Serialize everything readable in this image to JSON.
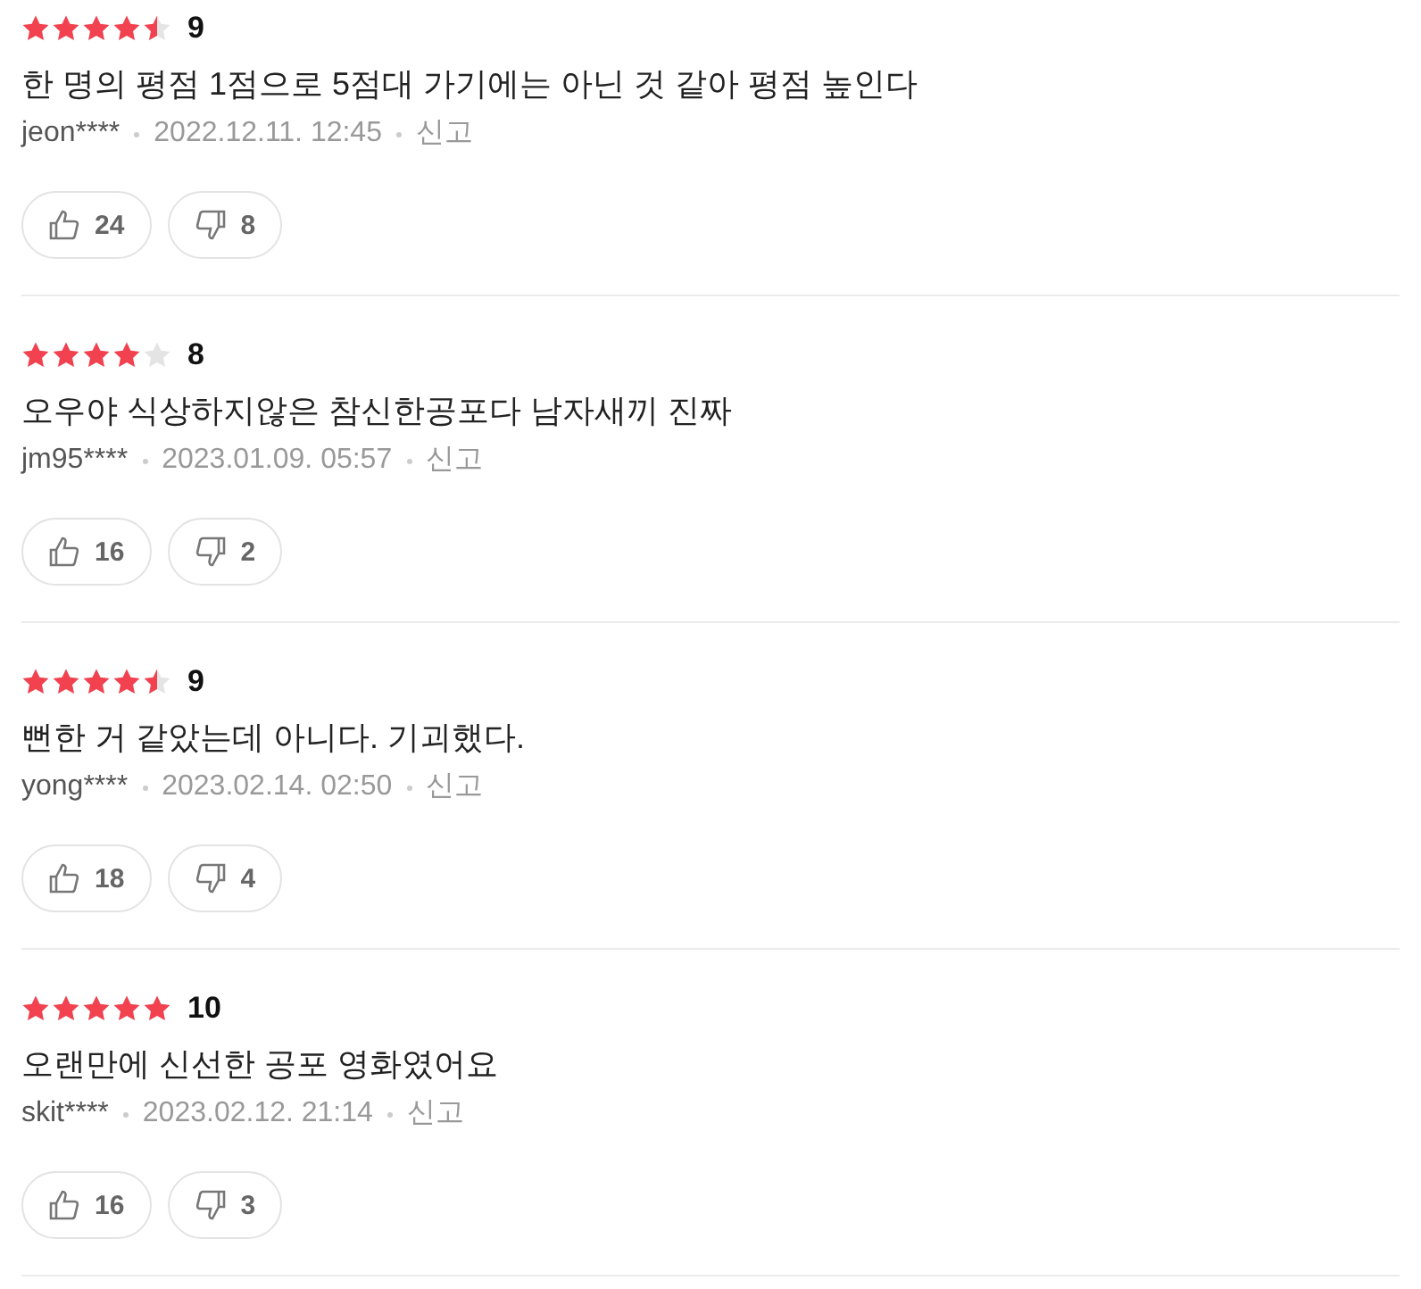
{
  "reviews": [
    {
      "stars": 4.5,
      "score": "9",
      "text": "한 명의 평점 1점으로 5점대 가기에는 아닌 것 같아 평점 높인다",
      "user": "jeon****",
      "date": "2022.12.11. 12:45",
      "report": "신고",
      "likes": "24",
      "dislikes": "8"
    },
    {
      "stars": 4,
      "score": "8",
      "text": "오우야 식상하지않은 참신한공포다 남자새끼 진짜",
      "user": "jm95****",
      "date": "2023.01.09. 05:57",
      "report": "신고",
      "likes": "16",
      "dislikes": "2"
    },
    {
      "stars": 4.5,
      "score": "9",
      "text": "뻔한 거 같았는데 아니다. 기괴했다.",
      "user": "yong****",
      "date": "2023.02.14. 02:50",
      "report": "신고",
      "likes": "18",
      "dislikes": "4"
    },
    {
      "stars": 5,
      "score": "10",
      "text": "오랜만에 신선한 공포 영화였어요",
      "user": "skit****",
      "date": "2023.02.12. 21:14",
      "report": "신고",
      "likes": "16",
      "dislikes": "3"
    }
  ]
}
